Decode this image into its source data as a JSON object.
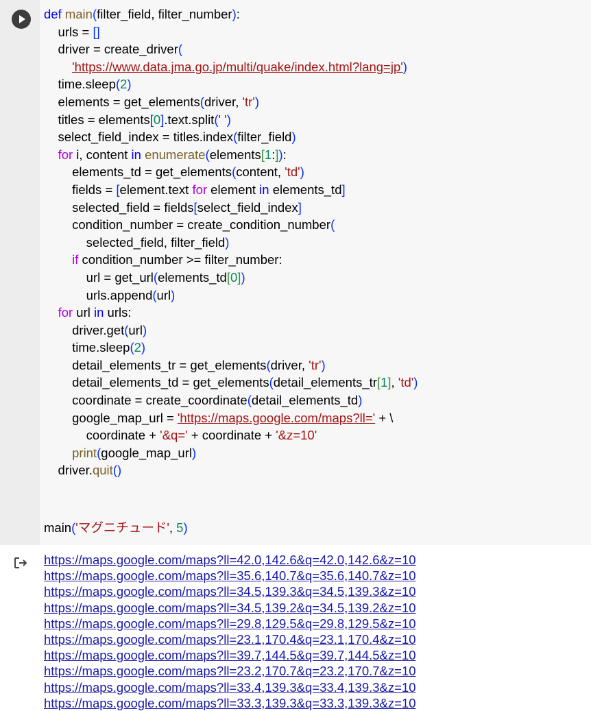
{
  "cell": {
    "run_button": "run-cell",
    "code": [
      [
        [
          "kw",
          "def "
        ],
        [
          "fn",
          "main"
        ],
        [
          "br1",
          "("
        ],
        [
          "t",
          "filter_field, filter_number"
        ],
        [
          "br1",
          ")"
        ],
        [
          "t",
          ":"
        ]
      ],
      [
        [
          "t",
          "    urls = "
        ],
        [
          "br1",
          "[]"
        ]
      ],
      [
        [
          "t",
          "    driver = "
        ],
        [
          "t",
          "create_driver"
        ],
        [
          "br1",
          "("
        ]
      ],
      [
        [
          "t",
          "        "
        ],
        [
          "url",
          "'https://www.data.jma.go.jp/multi/quake/index.html?lang=jp'"
        ],
        [
          "br1",
          ")"
        ]
      ],
      [
        [
          "t",
          "    time.sleep"
        ],
        [
          "br1",
          "("
        ],
        [
          "num",
          "2"
        ],
        [
          "br1",
          ")"
        ]
      ],
      [
        [
          "t",
          "    elements = get_elements"
        ],
        [
          "br1",
          "("
        ],
        [
          "t",
          "driver, "
        ],
        [
          "str",
          "'tr'"
        ],
        [
          "br1",
          ")"
        ]
      ],
      [
        [
          "t",
          "    titles = elements"
        ],
        [
          "br1",
          "["
        ],
        [
          "num",
          "0"
        ],
        [
          "br1",
          "]"
        ],
        [
          "t",
          ".text.split"
        ],
        [
          "br1",
          "("
        ],
        [
          "str",
          "' '"
        ],
        [
          "br1",
          ")"
        ]
      ],
      [
        [
          "t",
          "    select_field_index = titles.index"
        ],
        [
          "br1",
          "("
        ],
        [
          "t",
          "filter_field"
        ],
        [
          "br1",
          ")"
        ]
      ],
      [
        [
          "t",
          "    "
        ],
        [
          "ctrl",
          "for"
        ],
        [
          "t",
          " i, content "
        ],
        [
          "kw",
          "in"
        ],
        [
          "t",
          " "
        ],
        [
          "fn",
          "enumerate"
        ],
        [
          "br1",
          "("
        ],
        [
          "t",
          "elements"
        ],
        [
          "br2",
          "["
        ],
        [
          "num",
          "1"
        ],
        [
          "t",
          ":"
        ],
        [
          "br2",
          "]"
        ],
        [
          "br1",
          ")"
        ],
        [
          "t",
          ":"
        ]
      ],
      [
        [
          "t",
          "        elements_td = get_elements"
        ],
        [
          "br1",
          "("
        ],
        [
          "t",
          "content, "
        ],
        [
          "str",
          "'td'"
        ],
        [
          "br1",
          ")"
        ]
      ],
      [
        [
          "t",
          "        fields = "
        ],
        [
          "br1",
          "["
        ],
        [
          "t",
          "element.text "
        ],
        [
          "ctrl",
          "for"
        ],
        [
          "t",
          " element "
        ],
        [
          "kw",
          "in"
        ],
        [
          "t",
          " elements_td"
        ],
        [
          "br1",
          "]"
        ]
      ],
      [
        [
          "t",
          "        selected_field = fields"
        ],
        [
          "br1",
          "["
        ],
        [
          "t",
          "select_field_index"
        ],
        [
          "br1",
          "]"
        ]
      ],
      [
        [
          "t",
          "        condition_number = create_condition_number"
        ],
        [
          "br1",
          "("
        ]
      ],
      [
        [
          "t",
          "            selected_field, filter_field"
        ],
        [
          "br1",
          ")"
        ]
      ],
      [
        [
          "t",
          "        "
        ],
        [
          "ctrl",
          "if"
        ],
        [
          "t",
          " condition_number >= filter_number:"
        ]
      ],
      [
        [
          "t",
          "            url = get_url"
        ],
        [
          "br1",
          "("
        ],
        [
          "t",
          "elements_td"
        ],
        [
          "br2",
          "["
        ],
        [
          "num",
          "0"
        ],
        [
          "br2",
          "]"
        ],
        [
          "br1",
          ")"
        ]
      ],
      [
        [
          "t",
          "            urls.append"
        ],
        [
          "br1",
          "("
        ],
        [
          "t",
          "url"
        ],
        [
          "br1",
          ")"
        ]
      ],
      [
        [
          "t",
          "    "
        ],
        [
          "ctrl",
          "for"
        ],
        [
          "t",
          " url "
        ],
        [
          "kw",
          "in"
        ],
        [
          "t",
          " urls:"
        ]
      ],
      [
        [
          "t",
          "        driver.get"
        ],
        [
          "br1",
          "("
        ],
        [
          "t",
          "url"
        ],
        [
          "br1",
          ")"
        ]
      ],
      [
        [
          "t",
          "        time.sleep"
        ],
        [
          "br1",
          "("
        ],
        [
          "num",
          "2"
        ],
        [
          "br1",
          ")"
        ]
      ],
      [
        [
          "t",
          "        detail_elements_tr = get_elements"
        ],
        [
          "br1",
          "("
        ],
        [
          "t",
          "driver, "
        ],
        [
          "str",
          "'tr'"
        ],
        [
          "br1",
          ")"
        ]
      ],
      [
        [
          "t",
          "        detail_elements_td = get_elements"
        ],
        [
          "br1",
          "("
        ],
        [
          "t",
          "detail_elements_tr"
        ],
        [
          "br2",
          "["
        ],
        [
          "num",
          "1"
        ],
        [
          "br2",
          "]"
        ],
        [
          "t",
          ", "
        ],
        [
          "str",
          "'td'"
        ],
        [
          "br1",
          ")"
        ]
      ],
      [
        [
          "t",
          "        coordinate = create_coordinate"
        ],
        [
          "br1",
          "("
        ],
        [
          "t",
          "detail_elements_td"
        ],
        [
          "br1",
          ")"
        ]
      ],
      [
        [
          "t",
          "        google_map_url = "
        ],
        [
          "url",
          "'https://maps.google.com/maps?ll='"
        ],
        [
          "t",
          " + \\"
        ]
      ],
      [
        [
          "t",
          "            coordinate + "
        ],
        [
          "str",
          "'&q='"
        ],
        [
          "t",
          " + coordinate + "
        ],
        [
          "str",
          "'&z=10'"
        ]
      ],
      [
        [
          "t",
          "        "
        ],
        [
          "fn",
          "print"
        ],
        [
          "br1",
          "("
        ],
        [
          "t",
          "google_map_url"
        ],
        [
          "br1",
          ")"
        ]
      ],
      [
        [
          "t",
          "    driver."
        ],
        [
          "fn",
          "quit"
        ],
        [
          "br1",
          "()"
        ]
      ]
    ],
    "main_call": [
      [
        "t",
        "main"
      ],
      [
        "br1",
        "("
      ],
      [
        "str",
        "'マグニチュード'"
      ],
      [
        "t",
        ", "
      ],
      [
        "num",
        "5"
      ],
      [
        "br1",
        ")"
      ]
    ]
  },
  "output": {
    "icon": "output-redirect-icon",
    "lines": [
      "https://maps.google.com/maps?ll=42.0,142.6&q=42.0,142.6&z=10",
      "https://maps.google.com/maps?ll=35.6,140.7&q=35.6,140.7&z=10",
      "https://maps.google.com/maps?ll=34.5,139.3&q=34.5,139.3&z=10",
      "https://maps.google.com/maps?ll=34.5,139.2&q=34.5,139.2&z=10",
      "https://maps.google.com/maps?ll=29.8,129.5&q=29.8,129.5&z=10",
      "https://maps.google.com/maps?ll=23.1,170.4&q=23.1,170.4&z=10",
      "https://maps.google.com/maps?ll=39.7,144.5&q=39.7,144.5&z=10",
      "https://maps.google.com/maps?ll=23.2,170.7&q=23.2,170.7&z=10",
      "https://maps.google.com/maps?ll=33.4,139.3&q=33.4,139.3&z=10",
      "https://maps.google.com/maps?ll=33.3,139.3&q=33.3,139.3&z=10"
    ]
  }
}
